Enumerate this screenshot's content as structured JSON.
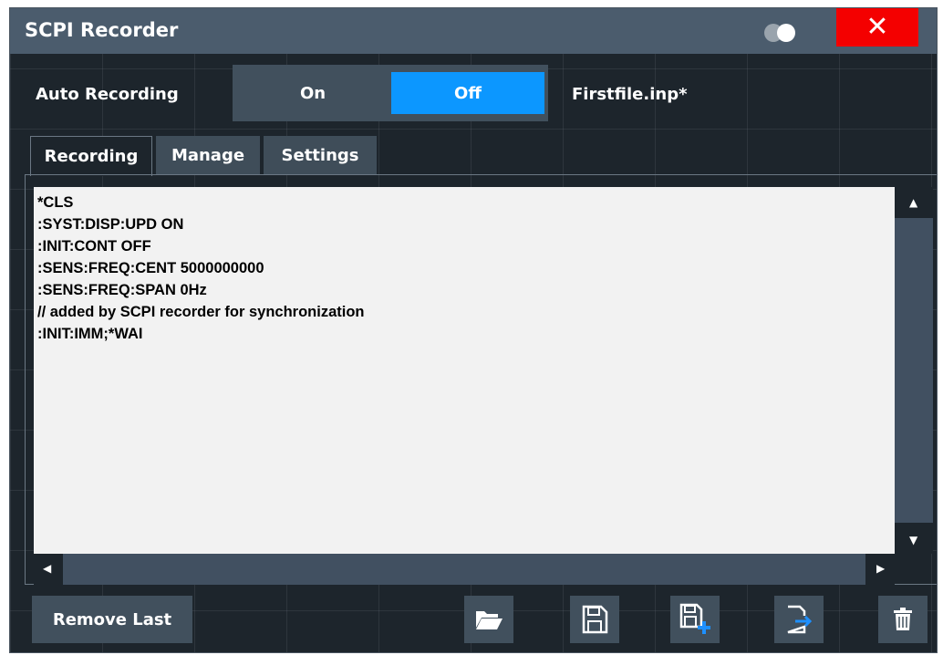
{
  "window": {
    "title": "SCPI Recorder",
    "close_glyph": "✕"
  },
  "auto_recording": {
    "label": "Auto Recording",
    "on_label": "On",
    "off_label": "Off",
    "selected": "Off",
    "filename": "Firstfile.inp*"
  },
  "tabs": [
    {
      "label": "Recording",
      "active": true
    },
    {
      "label": "Manage",
      "active": false
    },
    {
      "label": "Settings",
      "active": false
    }
  ],
  "editor": {
    "lines": [
      "*CLS",
      ":SYST:DISP:UPD ON",
      ":INIT:CONT OFF",
      ":SENS:FREQ:CENT 5000000000",
      ":SENS:FREQ:SPAN 0Hz",
      "// added by SCPI recorder for synchronization",
      ":INIT:IMM;*WAI"
    ]
  },
  "toolbar": {
    "remove_last_label": "Remove Last",
    "icons": [
      "open-folder-icon",
      "save-icon",
      "save-as-icon",
      "export-icon",
      "delete-icon"
    ]
  },
  "colors": {
    "title_bar": "#4b5c6d",
    "background": "#1d252c",
    "accent": "#0c97ff",
    "close": "#f40000",
    "button": "#41505d"
  }
}
